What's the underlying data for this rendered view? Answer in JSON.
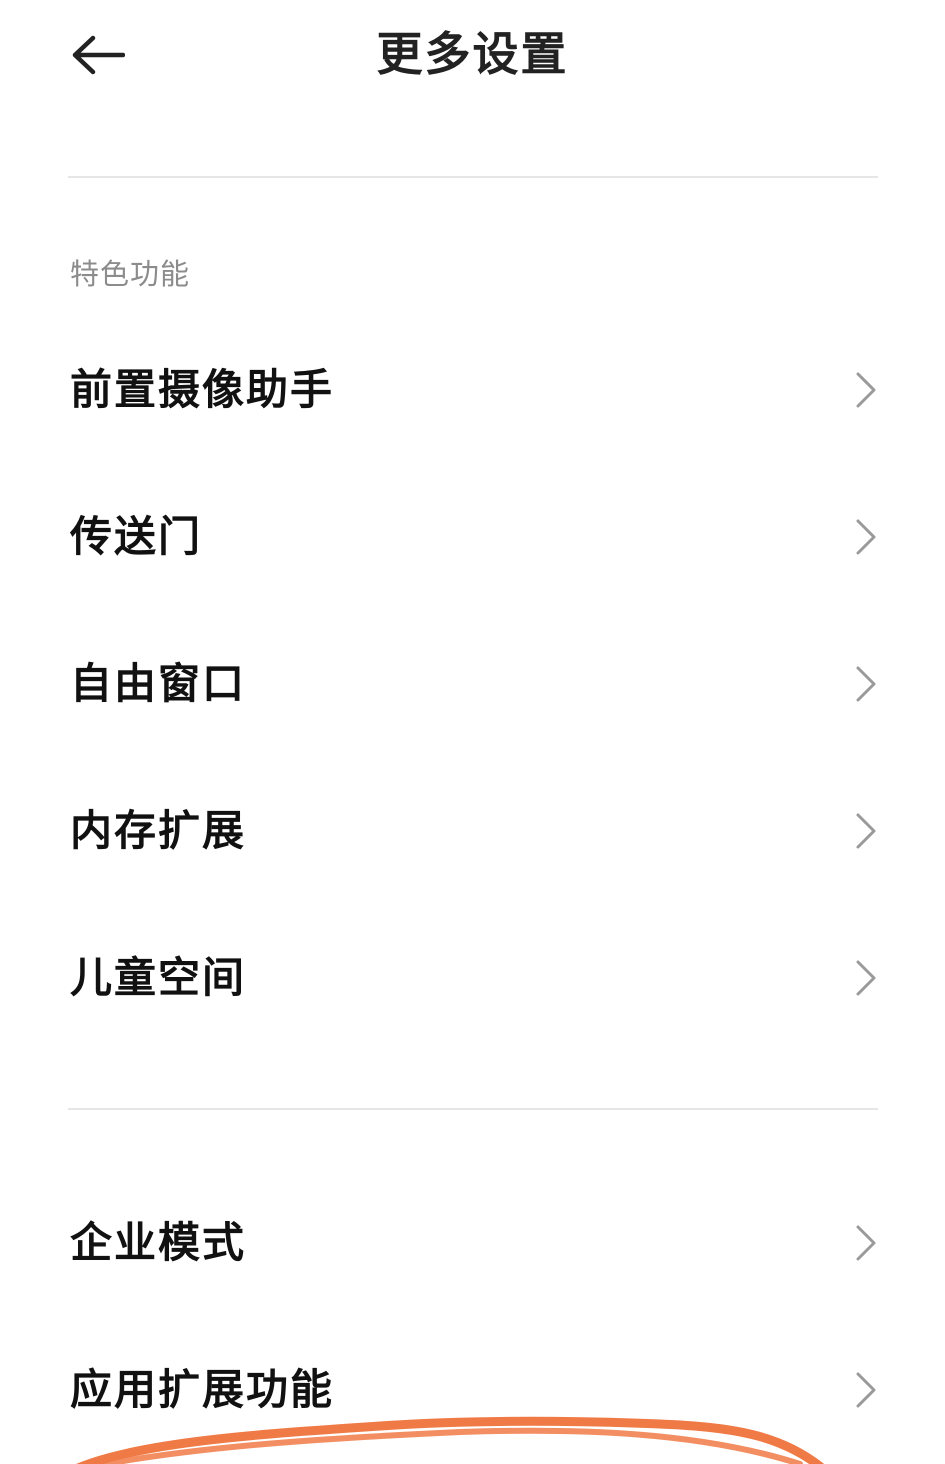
{
  "header": {
    "title": "更多设置",
    "back_icon": "back-arrow-icon"
  },
  "section": {
    "label": "特色功能",
    "items": [
      {
        "label": "前置摄像助手",
        "icon": "chevron-right-icon"
      },
      {
        "label": "传送门",
        "icon": "chevron-right-icon"
      },
      {
        "label": "自由窗口",
        "icon": "chevron-right-icon"
      },
      {
        "label": "内存扩展",
        "icon": "chevron-right-icon"
      },
      {
        "label": "儿童空间",
        "icon": "chevron-right-icon"
      }
    ]
  },
  "other": {
    "items": [
      {
        "label": "企业模式",
        "icon": "chevron-right-icon"
      },
      {
        "label": "应用扩展功能",
        "icon": "chevron-right-icon"
      }
    ]
  },
  "colors": {
    "text_primary": "#111111",
    "text_secondary": "#8c8c8c",
    "divider": "#e6e6e6",
    "chevron": "#9a9a9a",
    "annotation_stroke": "#f07a45"
  }
}
